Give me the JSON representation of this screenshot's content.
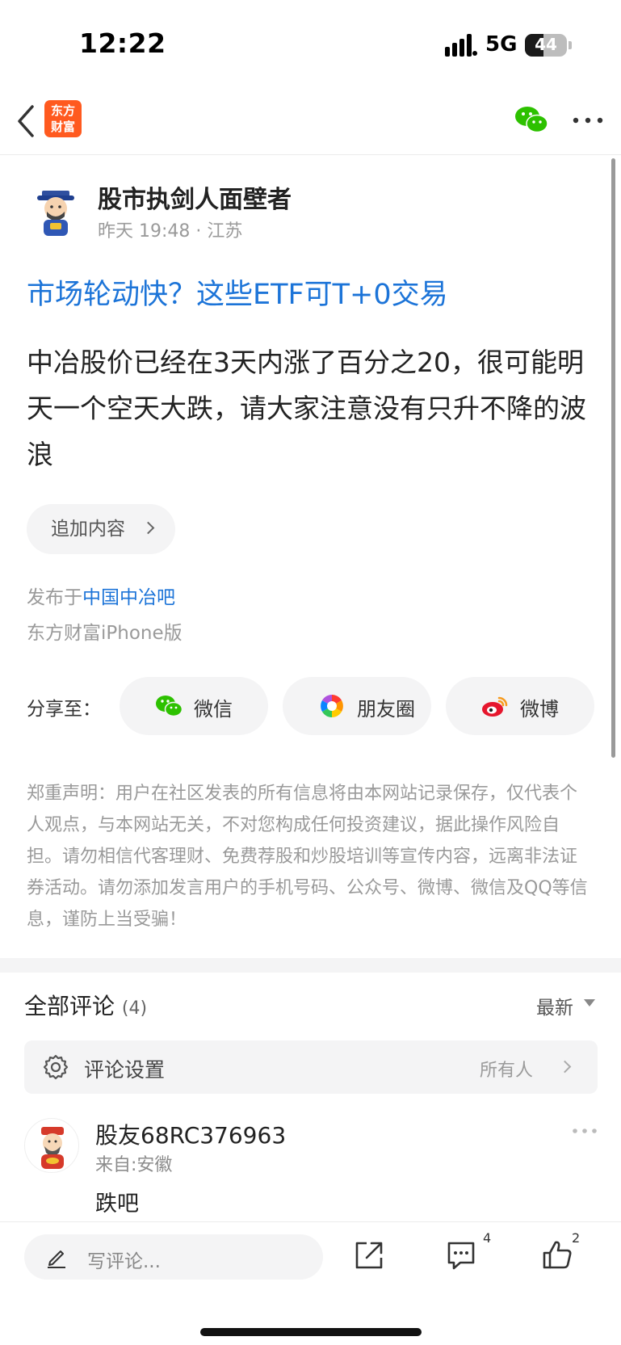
{
  "status_bar": {
    "time": "12:22",
    "network": "5G",
    "battery": "44",
    "battery_level": 0.44
  },
  "nav": {
    "logo_text_line1": "东方",
    "logo_text_line2": "财富",
    "accent": "#ff5a1f"
  },
  "post": {
    "author": "股市执剑人面壁者",
    "meta": "昨天 19:48 · 江苏",
    "title": "市场轮动快？这些ETF可T+0交易",
    "body": "中冶股价已经在3天内涨了百分之20，很可能明天一个空天大跌，请大家注意没有只升不降的波浪",
    "add_content_label": "追加内容",
    "published_prefix": "发布于",
    "published_board": "中国中冶吧",
    "client": "东方财富iPhone版",
    "link_color": "#1c74d8"
  },
  "share": {
    "label": "分享至：",
    "items": [
      {
        "label": "微信",
        "icon": "wechat-icon"
      },
      {
        "label": "朋友圈",
        "icon": "moments-icon"
      },
      {
        "label": "微博",
        "icon": "weibo-icon"
      }
    ]
  },
  "disclaimer": "郑重声明：用户在社区发表的所有信息将由本网站记录保存，仅代表个人观点，与本网站无关，不对您构成任何投资建议，据此操作风险自担。请勿相信代客理财、免费荐股和炒股培训等宣传内容，远离非法证券活动。请勿添加发言用户的手机号码、公众号、微博、微信及QQ等信息，谨防上当受骗！",
  "comments": {
    "title": "全部评论",
    "count": "(4)",
    "sort": "最新",
    "settings_label": "评论设置",
    "settings_value": "所有人",
    "items": [
      {
        "user": "股友68RC376963",
        "location": "来自:安徽",
        "text": "跌吧"
      }
    ]
  },
  "bottom_bar": {
    "input_placeholder": "写评论...",
    "comment_count": "4",
    "like_count": "2"
  }
}
